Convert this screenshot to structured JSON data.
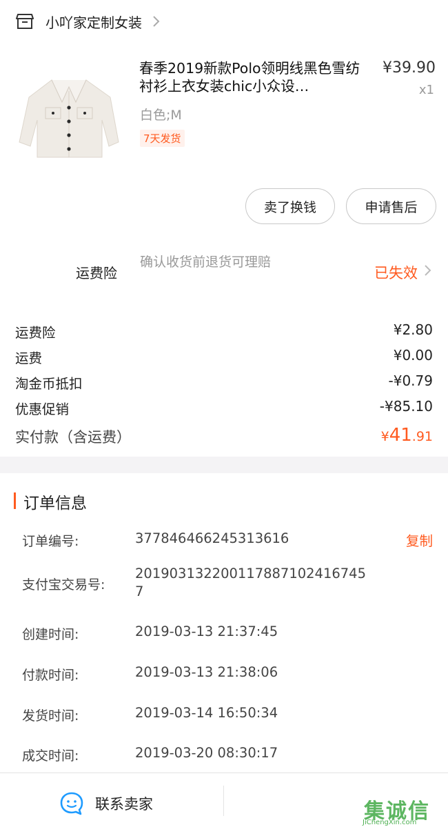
{
  "shop": {
    "name": "小吖家定制女装",
    "icon": "shop-icon"
  },
  "item": {
    "title": "春季2019新款Polo领明线黑色雪纺衬衫上衣女装chic小众设…",
    "price": "¥39.90",
    "quantity": "x1",
    "spec": "白色;M",
    "shipping_badge": "7天发货"
  },
  "actions": {
    "sell_label": "卖了换钱",
    "after_sale_label": "申请售后"
  },
  "insurance": {
    "label": "运费险",
    "description": "确认收货前退货可理赔",
    "status": "已失效"
  },
  "fees": [
    {
      "label": "运费险",
      "value": "¥2.80"
    },
    {
      "label": "运费",
      "value": "¥0.00"
    },
    {
      "label": "淘金币抵扣",
      "value": "-¥0.79"
    },
    {
      "label": "优惠促销",
      "value": "-¥85.10"
    }
  ],
  "total": {
    "label": "实付款（含运费）",
    "currency": "¥",
    "integer": "41",
    "decimal": ".91"
  },
  "order": {
    "title": "订单信息",
    "copy_label": "复制",
    "rows": [
      {
        "label": "订单编号:",
        "value": "377846466245313616"
      },
      {
        "label": "支付宝交易号:",
        "value": "2019031322001178871024167457"
      },
      {
        "label": "创建时间:",
        "value": "2019-03-13 21:37:45"
      },
      {
        "label": "付款时间:",
        "value": "2019-03-13 21:38:06"
      },
      {
        "label": "发货时间:",
        "value": "2019-03-14 16:50:34"
      },
      {
        "label": "成交时间:",
        "value": "2019-03-20 08:30:17"
      }
    ]
  },
  "bottom": {
    "contact_label": "联系卖家"
  },
  "watermark": {
    "text": "集诚信",
    "sub": "JiChengXin.com"
  },
  "colors": {
    "accent": "#ff5a1f",
    "muted": "#999999",
    "divider_bg": "#f4f3f5",
    "icon_blue": "#1e9bff"
  }
}
